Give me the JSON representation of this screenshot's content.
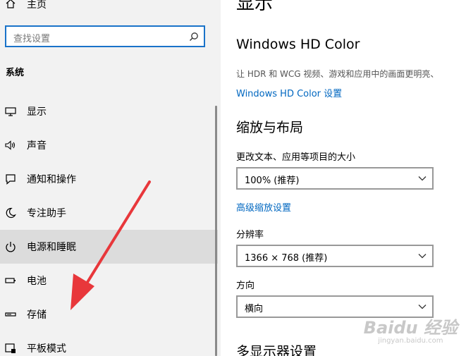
{
  "sidebar": {
    "home_label": "主页",
    "search_placeholder": "查找设置",
    "section_title": "系统",
    "items": [
      {
        "label": "显示",
        "icon": "monitor-icon"
      },
      {
        "label": "声音",
        "icon": "speaker-icon"
      },
      {
        "label": "通知和操作",
        "icon": "notification-icon"
      },
      {
        "label": "专注助手",
        "icon": "moon-icon"
      },
      {
        "label": "电源和睡眠",
        "icon": "power-icon",
        "selected": true
      },
      {
        "label": "电池",
        "icon": "battery-icon"
      },
      {
        "label": "存储",
        "icon": "storage-icon"
      },
      {
        "label": "平板模式",
        "icon": "tablet-icon"
      }
    ]
  },
  "main": {
    "page_title": "显示",
    "hd_color": {
      "title": "Windows HD Color",
      "description": "让 HDR 和 WCG 视频、游戏和应用中的画面更明亮、",
      "link": "Windows HD Color 设置"
    },
    "scale_layout": {
      "title": "缩放与布局",
      "scale_label": "更改文本、应用等项目的大小",
      "scale_value": "100% (推荐)",
      "advanced_link": "高级缩放设置",
      "resolution_label": "分辨率",
      "resolution_value": "1366 × 768 (推荐)",
      "orientation_label": "方向",
      "orientation_value": "横向"
    },
    "multi_display_title": "多显示器设置"
  },
  "watermark": {
    "brand": "Baidu 经验",
    "url": "jingyan.baidu.com"
  },
  "colors": {
    "accent": "#0067c0",
    "search_border": "#1a73c9",
    "arrow": "#e8373b",
    "sidebar_bg": "#f2f2f2",
    "selected_bg": "#dcdcdc"
  }
}
